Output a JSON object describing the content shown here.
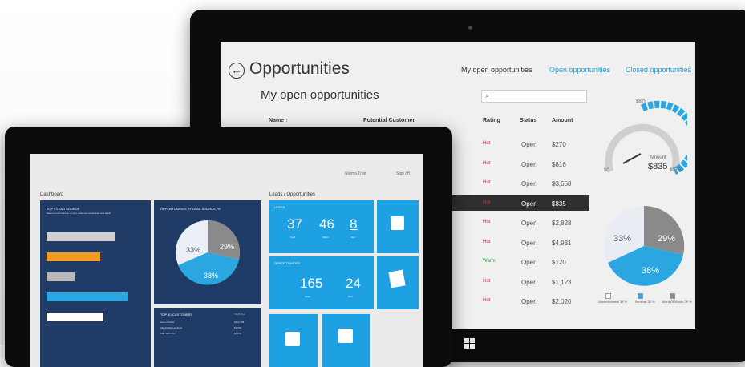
{
  "big": {
    "title": "Opportunities",
    "nav": {
      "my": "My open opportunities",
      "open": "Open opportunities",
      "closed": "Closed opportunities"
    },
    "subtitle": "My open opportunities",
    "search_icon": "search-icon",
    "columns": {
      "name": "Name ↑",
      "customer": "Potential Customer",
      "rating": "Rating",
      "status": "Status",
      "amount": "Amount"
    },
    "rows": [
      {
        "rating": "Hot",
        "status": "Open",
        "amount": "$270"
      },
      {
        "rating": "Hot",
        "status": "Open",
        "amount": "$816"
      },
      {
        "rating": "Hot",
        "status": "Open",
        "amount": "$3,658"
      },
      {
        "rating": "Hot",
        "status": "Open",
        "amount": "$835"
      },
      {
        "rating": "Hot",
        "status": "Open",
        "amount": "$2,828"
      },
      {
        "rating": "Hot",
        "status": "Open",
        "amount": "$4,931"
      },
      {
        "rating": "Warm",
        "status": "Open",
        "amount": "$120"
      },
      {
        "rating": "Hot",
        "status": "Open",
        "amount": "$1,123"
      },
      {
        "rating": "Hot",
        "status": "Open",
        "amount": "$2,020"
      }
    ],
    "gauge": {
      "top": "$875",
      "min": "$0",
      "max": "$1750",
      "label": "Amount",
      "value": "$835"
    },
    "pie": {
      "a": "33%",
      "b": "29%",
      "c": "38%"
    },
    "legend": [
      {
        "label": "Advertisement 33 %",
        "color": "#ffffff"
      },
      {
        "label": "Seminar 38 %",
        "color": "#2aa7e0"
      },
      {
        "label": "Word Of Mouth 29 %",
        "color": "#8a8a8a"
      }
    ],
    "colors": {
      "accent": "#1da1e2",
      "hot": "#d9332a",
      "warm": "#2b9a3a"
    }
  },
  "small": {
    "user": "Norma Tran",
    "signout": "Sign off",
    "dashboard": "Dashboard",
    "leads": "Leads / Opportunities",
    "topsource": "TOP 5 LEAD SOURCE",
    "topsource_sub": "Based on the lifetime of your customer acquisition and leads",
    "pie_title": "OPPORTUNITIES BY LEAD SOURCE, %",
    "pie": {
      "a": "33%",
      "b": "29%",
      "c": "38%"
    },
    "leads_tile": {
      "label": "LEADS",
      "n1": "37",
      "n2": "46",
      "n3": "8",
      "l1": "Cold",
      "l2": "Warm",
      "l3": "Hot"
    },
    "opps_tile": {
      "label": "OPPORTUNITIES",
      "n1": "165",
      "n2": "24",
      "l1": "Open",
      "l2": "Won"
    },
    "top10": "TOP 10 CUSTOMERS",
    "top10_link": "VIEW ALL",
    "customers": [
      {
        "name": "Acme Mobile",
        "value": "$112,158"
      },
      {
        "name": "VELANDIA Holdings",
        "value": "$2,381"
      },
      {
        "name": "Fab Tech LTD",
        "value": "$2,295"
      }
    ],
    "bars": [
      {
        "value": 0.75,
        "color": "#d0d0d0"
      },
      {
        "value": 0.58,
        "color": "#f39b1f"
      },
      {
        "value": 0.3,
        "color": "#b8b8b8"
      },
      {
        "value": 0.88,
        "color": "#2aa7e0"
      },
      {
        "value": 0.62,
        "color": "#ffffff"
      }
    ]
  }
}
